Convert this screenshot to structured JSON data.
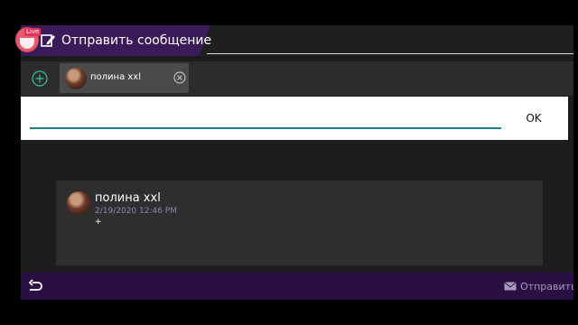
{
  "header": {
    "title": "Отправить сообщение",
    "live_badge": "Live"
  },
  "recipients": [
    {
      "name": "полина xxl"
    }
  ],
  "input": {
    "value": "",
    "placeholder": "",
    "ok_label": "OK"
  },
  "preview": {
    "name": "полина xxl",
    "timestamp": "2/19/2020 12:46 PM",
    "body": "+"
  },
  "footer": {
    "send_label": "Отправить"
  },
  "colors": {
    "title_tab": "#3b1a5a",
    "bottom_bar": "#2a0f44",
    "input_underline": "#1a7f8e",
    "live_badge": "#e85a6b"
  }
}
